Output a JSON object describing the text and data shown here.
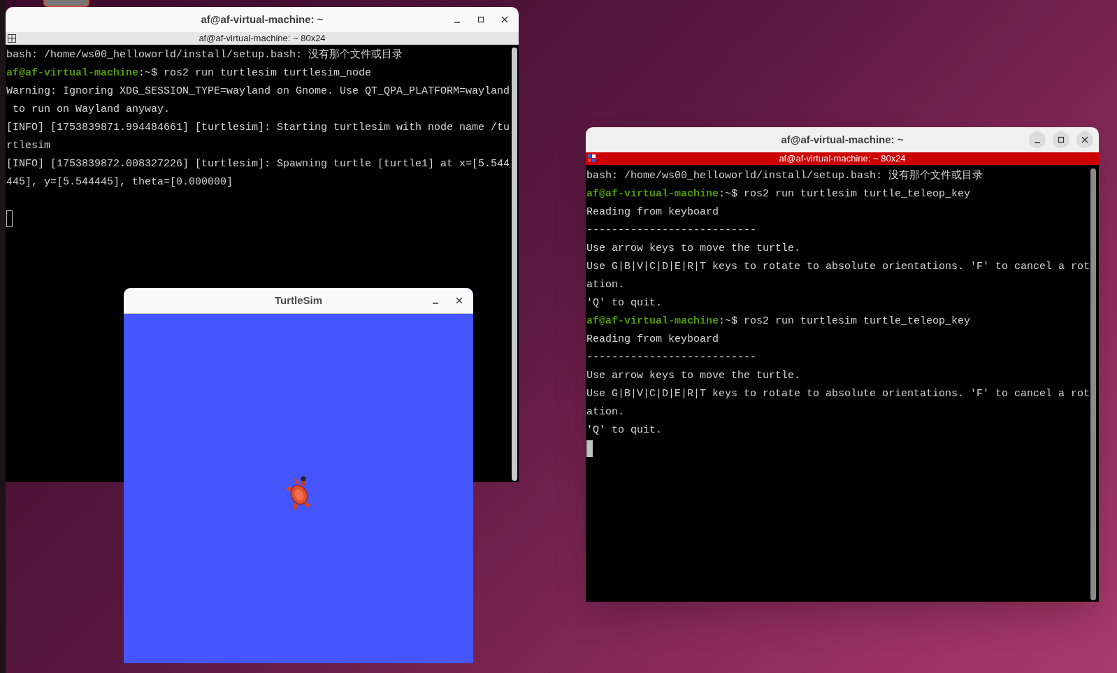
{
  "terminals": [
    {
      "title": "af@af-virtual-machine: ~",
      "header": "af@af-virtual-machine: ~ 80x24",
      "focused": false,
      "lines": [
        {
          "kind": "output",
          "text": "bash: /home/ws00_helloworld/install/setup.bash: 没有那个文件或目录"
        },
        {
          "kind": "prompt",
          "user": "af@af-virtual-machine",
          "text": ":~$ ros2 run turtlesim turtlesim_node"
        },
        {
          "kind": "output",
          "text": "Warning: Ignoring XDG_SESSION_TYPE=wayland on Gnome. Use QT_QPA_PLATFORM=wayland"
        },
        {
          "kind": "output",
          "text": " to run on Wayland anyway."
        },
        {
          "kind": "output",
          "text": "[INFO] [1753839871.994484661] [turtlesim]: Starting turtlesim with node name /tu"
        },
        {
          "kind": "output",
          "text": "rtlesim"
        },
        {
          "kind": "output",
          "text": "[INFO] [1753839872.008327226] [turtlesim]: Spawning turtle [turtle1] at x=[5.544"
        },
        {
          "kind": "output",
          "text": "445], y=[5.544445], theta=[0.000000]"
        },
        {
          "kind": "blank"
        }
      ]
    },
    {
      "title": "af@af-virtual-machine: ~",
      "header": "af@af-virtual-machine: ~ 80x24",
      "focused": true,
      "lines": [
        {
          "kind": "output",
          "text": "bash: /home/ws00_helloworld/install/setup.bash: 没有那个文件或目录"
        },
        {
          "kind": "prompt",
          "user": "af@af-virtual-machine",
          "text": ":~$ ros2 run turtlesim turtle_teleop_key"
        },
        {
          "kind": "output",
          "text": "Reading from keyboard"
        },
        {
          "kind": "output",
          "text": "---------------------------"
        },
        {
          "kind": "output",
          "text": "Use arrow keys to move the turtle."
        },
        {
          "kind": "output",
          "text": "Use G|B|V|C|D|E|R|T keys to rotate to absolute orientations. 'F' to cancel a rot"
        },
        {
          "kind": "output",
          "text": "ation."
        },
        {
          "kind": "output",
          "text": "'Q' to quit."
        },
        {
          "kind": "prompt",
          "user": "af@af-virtual-machine",
          "text": ":~$ ros2 run turtlesim turtle_teleop_key"
        },
        {
          "kind": "output",
          "text": "Reading from keyboard"
        },
        {
          "kind": "output",
          "text": "---------------------------"
        },
        {
          "kind": "output",
          "text": "Use arrow keys to move the turtle."
        },
        {
          "kind": "output",
          "text": "Use G|B|V|C|D|E|R|T keys to rotate to absolute orientations. 'F' to cancel a rot"
        },
        {
          "kind": "output",
          "text": "ation."
        },
        {
          "kind": "output",
          "text": "'Q' to quit."
        }
      ]
    }
  ],
  "turtlesim": {
    "title": "TurtleSim"
  }
}
